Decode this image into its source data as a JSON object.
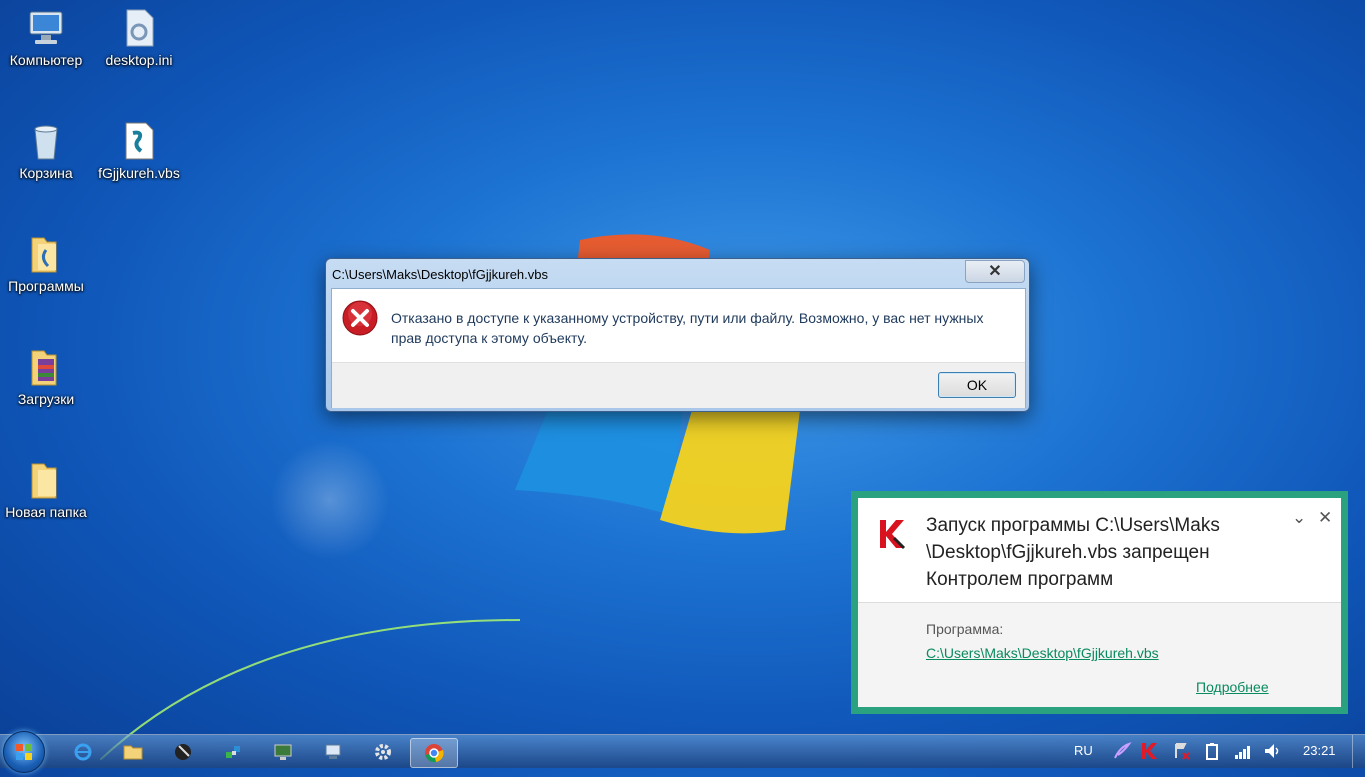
{
  "desktop": {
    "icons": [
      {
        "label": "Компьютер",
        "icon": "computer-icon"
      },
      {
        "label": "desktop.ini",
        "icon": "settings-file-icon"
      },
      {
        "label": "Корзина",
        "icon": "recycle-bin-icon"
      },
      {
        "label": "fGjjkureh.vbs",
        "icon": "script-file-icon"
      },
      {
        "label": "Программы",
        "icon": "folder-icon"
      },
      {
        "label": "Загрузки",
        "icon": "archive-folder-icon"
      },
      {
        "label": "Новая папка",
        "icon": "folder-icon"
      }
    ]
  },
  "error_dialog": {
    "title": "C:\\Users\\Maks\\Desktop\\fGjjkureh.vbs",
    "close_label": "✕",
    "message": "Отказано в доступе к указанному устройству, пути или файлу. Возможно,  у вас нет нужных прав доступа к этому объекту.",
    "ok_label": "OK",
    "icon": "error-icon"
  },
  "kaspersky": {
    "header_text": "Запуск программы C:\\Users\\Maks \\Desktop\\fGjjkureh.vbs запрещен Контролем программ",
    "program_label": "Программа:",
    "program_path": "C:\\Users\\Maks\\Desktop\\fGjjkureh.vbs",
    "more_link": "Подробнее",
    "collapse_label": "⌄",
    "close_label": "✕",
    "accent_color": "#2aa27f"
  },
  "taskbar": {
    "buttons": [
      "ie-icon",
      "explorer-icon",
      "media-player-icon",
      "puzzle-app-icon",
      "monitor-app-icon",
      "network-app-icon",
      "settings-app-icon",
      "chrome-icon"
    ],
    "tray": {
      "language": "RU",
      "clock": "23:21"
    }
  }
}
